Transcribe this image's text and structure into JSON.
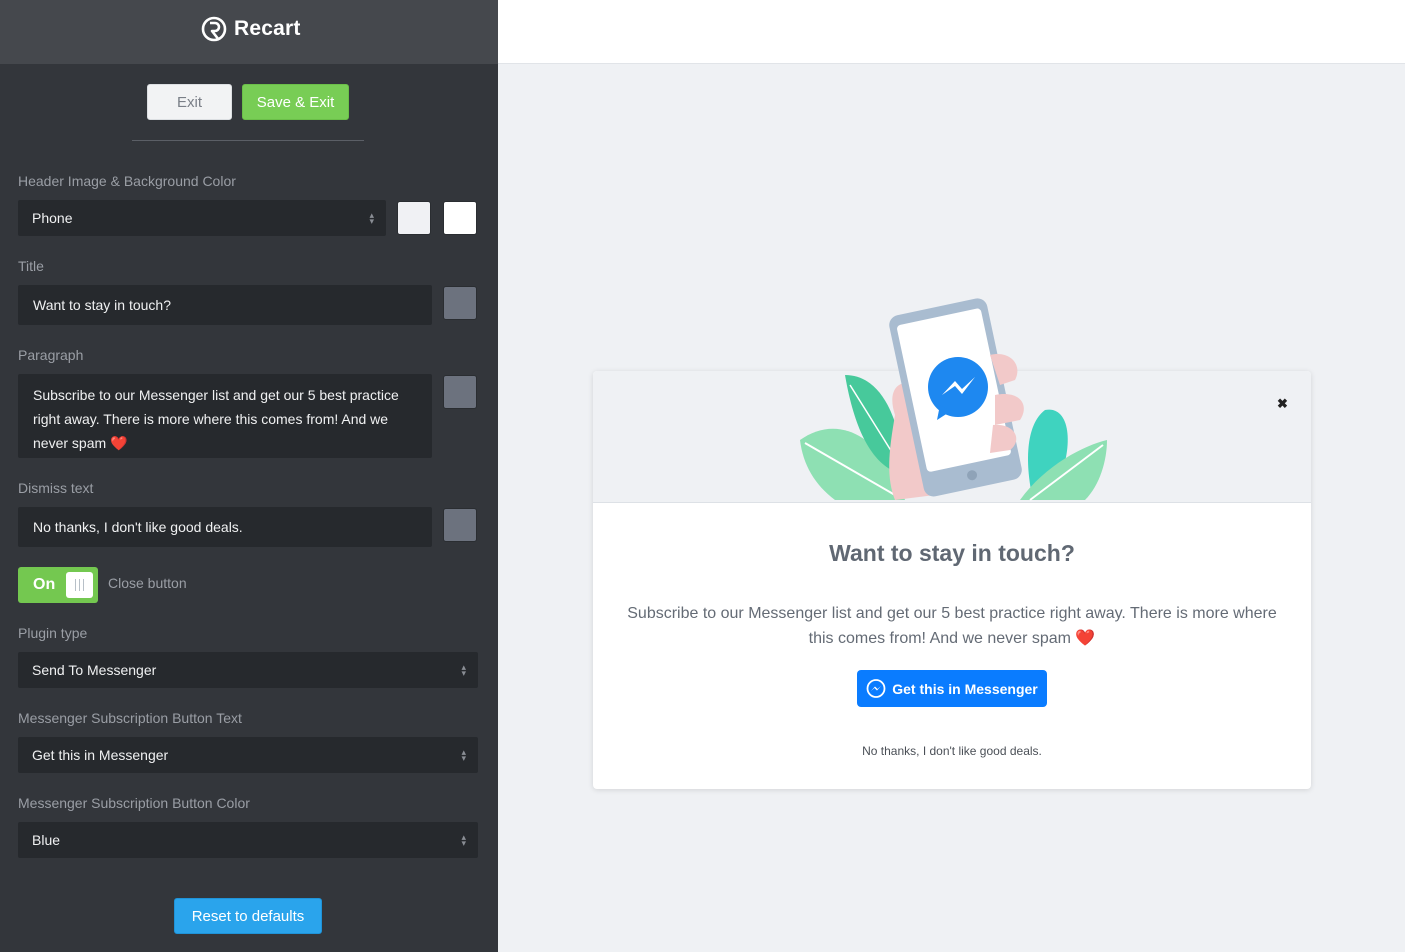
{
  "brand": {
    "name": "Recart"
  },
  "actions": {
    "exit_label": "Exit",
    "save_label": "Save & Exit",
    "reset_label": "Reset to defaults"
  },
  "settings": {
    "header_image": {
      "label": "Header Image & Background Color",
      "value": "Phone",
      "color1": "#f0f1f4",
      "color2": "#ffffff"
    },
    "title": {
      "label": "Title",
      "value": "Want to stay in touch?",
      "color": "#6c727e"
    },
    "paragraph": {
      "label": "Paragraph",
      "value": "Subscribe to our Messenger list and get our 5 best practice right away.  There is more where this comes from! And we never spam ❤️",
      "color": "#6c727e"
    },
    "dismiss": {
      "label": "Dismiss text",
      "value": "No thanks, I don't like good deals.",
      "color": "#6c727e"
    },
    "close_button": {
      "label": "Close button",
      "state": "On"
    },
    "plugin_type": {
      "label": "Plugin type",
      "value": "Send To Messenger"
    },
    "button_text": {
      "label": "Messenger Subscription Button Text",
      "value": "Get this in Messenger"
    },
    "button_color": {
      "label": "Messenger Subscription Button Color",
      "value": "Blue"
    }
  },
  "preview": {
    "close_icon": "✖",
    "title": "Want to stay in touch?",
    "paragraph": "Subscribe to our Messenger list and get our 5 best practice right away. There is more where this comes from! And we never spam ❤️",
    "button_label": "Get this in Messenger",
    "button_color": "#0a7cff",
    "dismiss": "No thanks, I don't like good deals."
  },
  "colors": {
    "sidebar": "#33363b",
    "accent_green": "#78cd55",
    "accent_blue": "#2aa4ec"
  }
}
